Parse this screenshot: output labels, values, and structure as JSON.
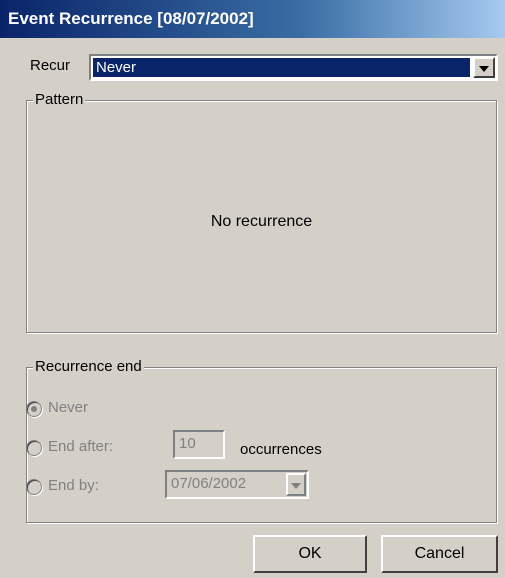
{
  "window": {
    "title": "Event Recurrence [08/07/2002]"
  },
  "recur": {
    "label": "Recur",
    "value": "Never"
  },
  "pattern": {
    "title": "Pattern",
    "message": "No recurrence"
  },
  "recurrence_end": {
    "title": "Recurrence end",
    "options": [
      {
        "label": "Never",
        "selected": true
      },
      {
        "label": "End after:",
        "selected": false
      },
      {
        "label": "End by:",
        "selected": false
      }
    ],
    "occurrences_value": "10",
    "occurrences_label": "occurrences",
    "end_date": "07/06/2002"
  },
  "buttons": {
    "ok": "OK",
    "cancel": "Cancel"
  }
}
